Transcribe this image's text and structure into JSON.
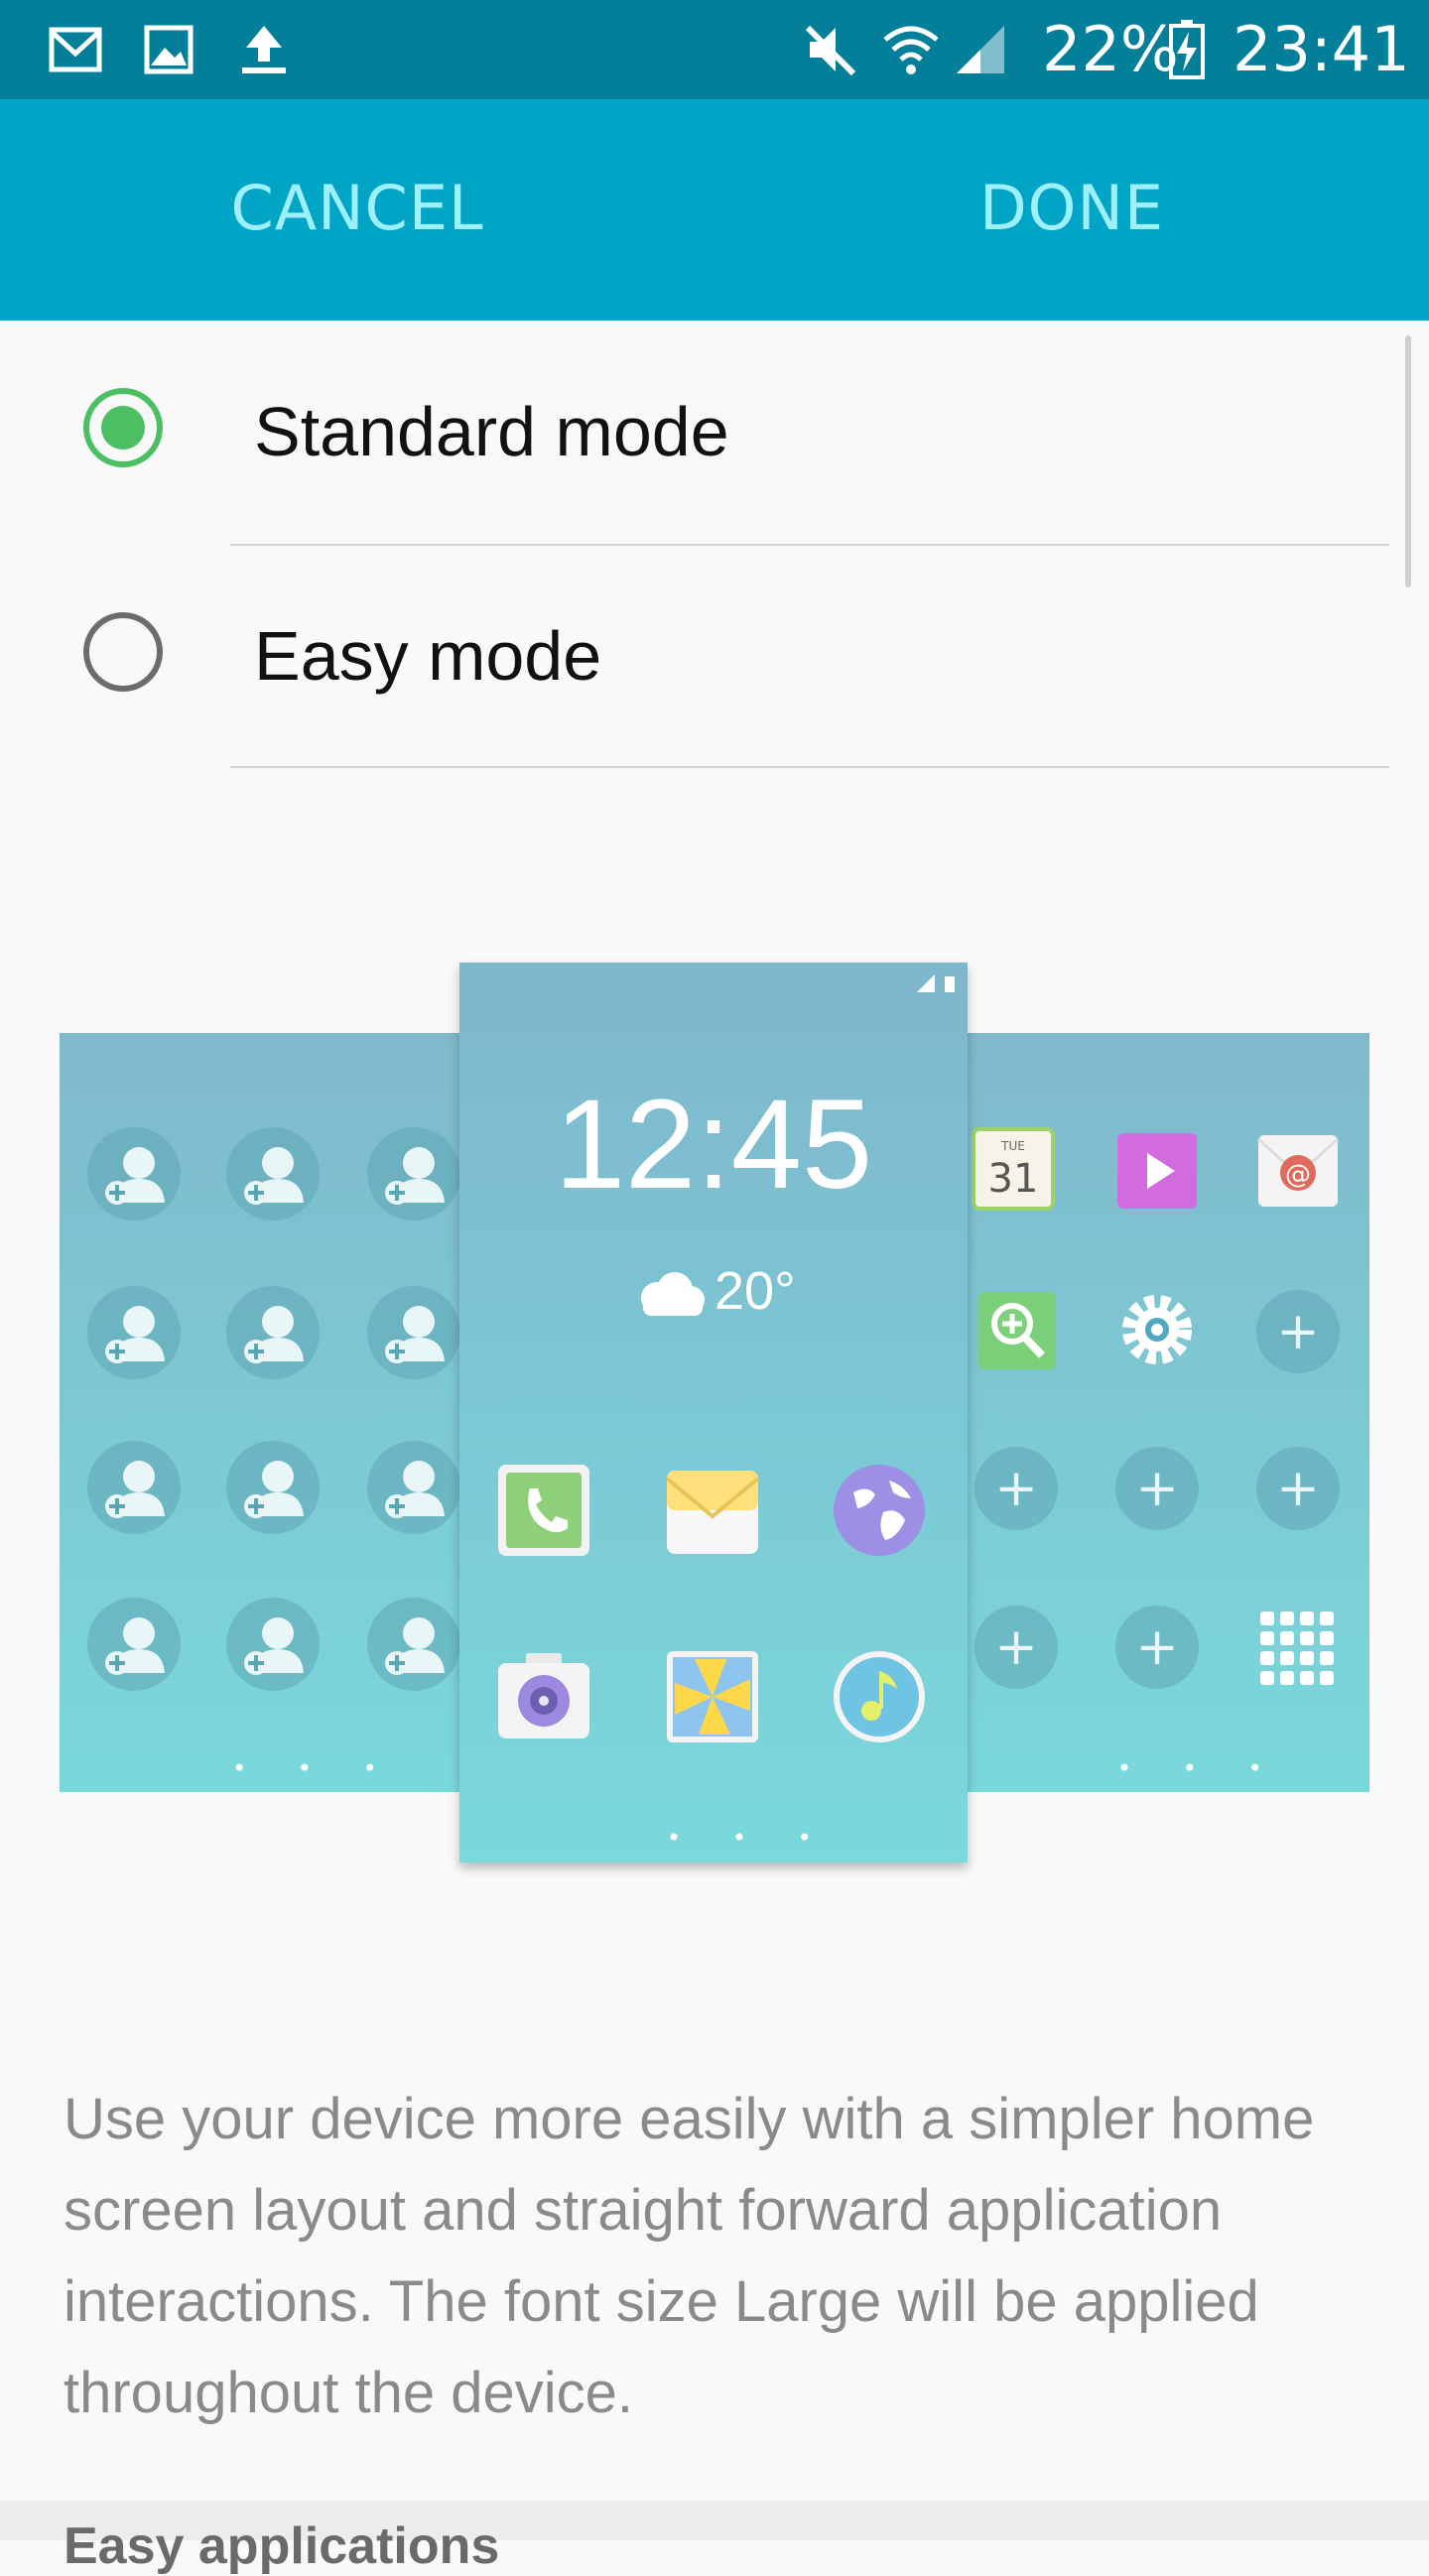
{
  "status_bar": {
    "battery_percent": "22%",
    "time": "23:41",
    "icons": [
      "gmail-icon",
      "gallery-icon",
      "upload-icon",
      "mute-icon",
      "wifi-icon",
      "signal-icon",
      "battery-charging-icon"
    ]
  },
  "action_bar": {
    "cancel_label": "CANCEL",
    "done_label": "DONE"
  },
  "options": [
    {
      "label": "Standard mode",
      "selected": true
    },
    {
      "label": "Easy mode",
      "selected": false
    }
  ],
  "preview": {
    "clock": "12:45",
    "temperature": "20°",
    "page_dots": "• • •"
  },
  "description": "Use your device more easily with a simpler home screen layout and straight forward application interactions. The font size Large will be applied throughout the device.",
  "next_section_label": "Easy applications",
  "colors": {
    "status_bar": "#047f99",
    "action_bar": "#00a5c6",
    "action_text": "#9ff0ff",
    "radio_selected": "#4cbf63"
  }
}
